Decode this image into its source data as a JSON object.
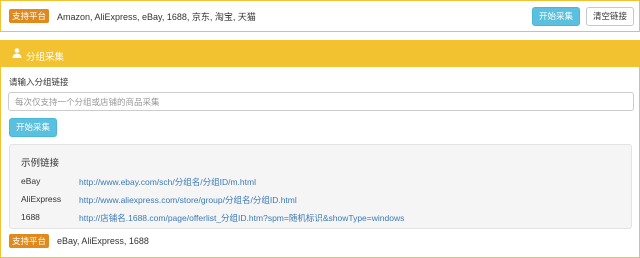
{
  "top_bar": {
    "badge": "支持平台",
    "platforms": "Amazon, AliExpress, eBay, 1688, 京东, 淘宝, 天猫",
    "start_button": "开始采集",
    "clear_button": "清空链接"
  },
  "group_panel": {
    "icon": "user-group-icon",
    "title": "分组采集",
    "input_label": "请输入分组链接",
    "input_placeholder": "每次仅支持一个分组或店铺的商品采集",
    "input_value": "",
    "start_button": "开始采集",
    "examples": {
      "title": "示例链接",
      "rows": [
        {
          "name": "eBay",
          "url": "http://www.ebay.com/sch/分组名/分组ID/m.html"
        },
        {
          "name": "AliExpress",
          "url": "http://www.aliexpress.com/store/group/分组名/分组ID.html"
        },
        {
          "name": "1688",
          "url": "http://店铺名.1688.com/page/offerlist_分组ID.htm?spm=随机标识&showType=windows"
        }
      ]
    },
    "support_badge": "支持平台",
    "support_platforms": "eBay, AliExpress, 1688"
  },
  "colors": {
    "accent_yellow": "#f3c230",
    "badge_orange": "#e08a1e",
    "button_blue": "#5bc0de",
    "link_blue": "#3a7ab8"
  }
}
